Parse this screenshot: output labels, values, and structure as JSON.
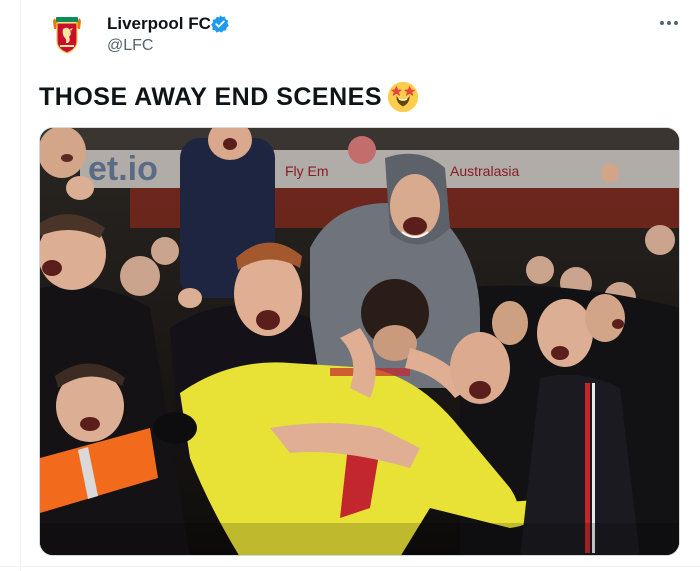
{
  "tweet": {
    "author": {
      "display_name": "Liverpool FC",
      "handle": "@LFC",
      "verified": true,
      "avatar_icon": "liverpool-crest-icon"
    },
    "text": "THOSE AWAY END SCENES",
    "emoji": "star-struck-emoji",
    "media": {
      "type": "photo",
      "banner_texts": [
        "Fly Em",
        "Australasia"
      ],
      "sponsor_text": "et.io"
    }
  },
  "colors": {
    "text_primary": "#0f1419",
    "text_secondary": "#536471",
    "verified_blue": "#1d9bf0",
    "crest_red": "#c8102e",
    "kit_yellow": "#e8e237"
  },
  "icons": {
    "verified": "verified-badge-icon",
    "more": "more-options-icon"
  }
}
